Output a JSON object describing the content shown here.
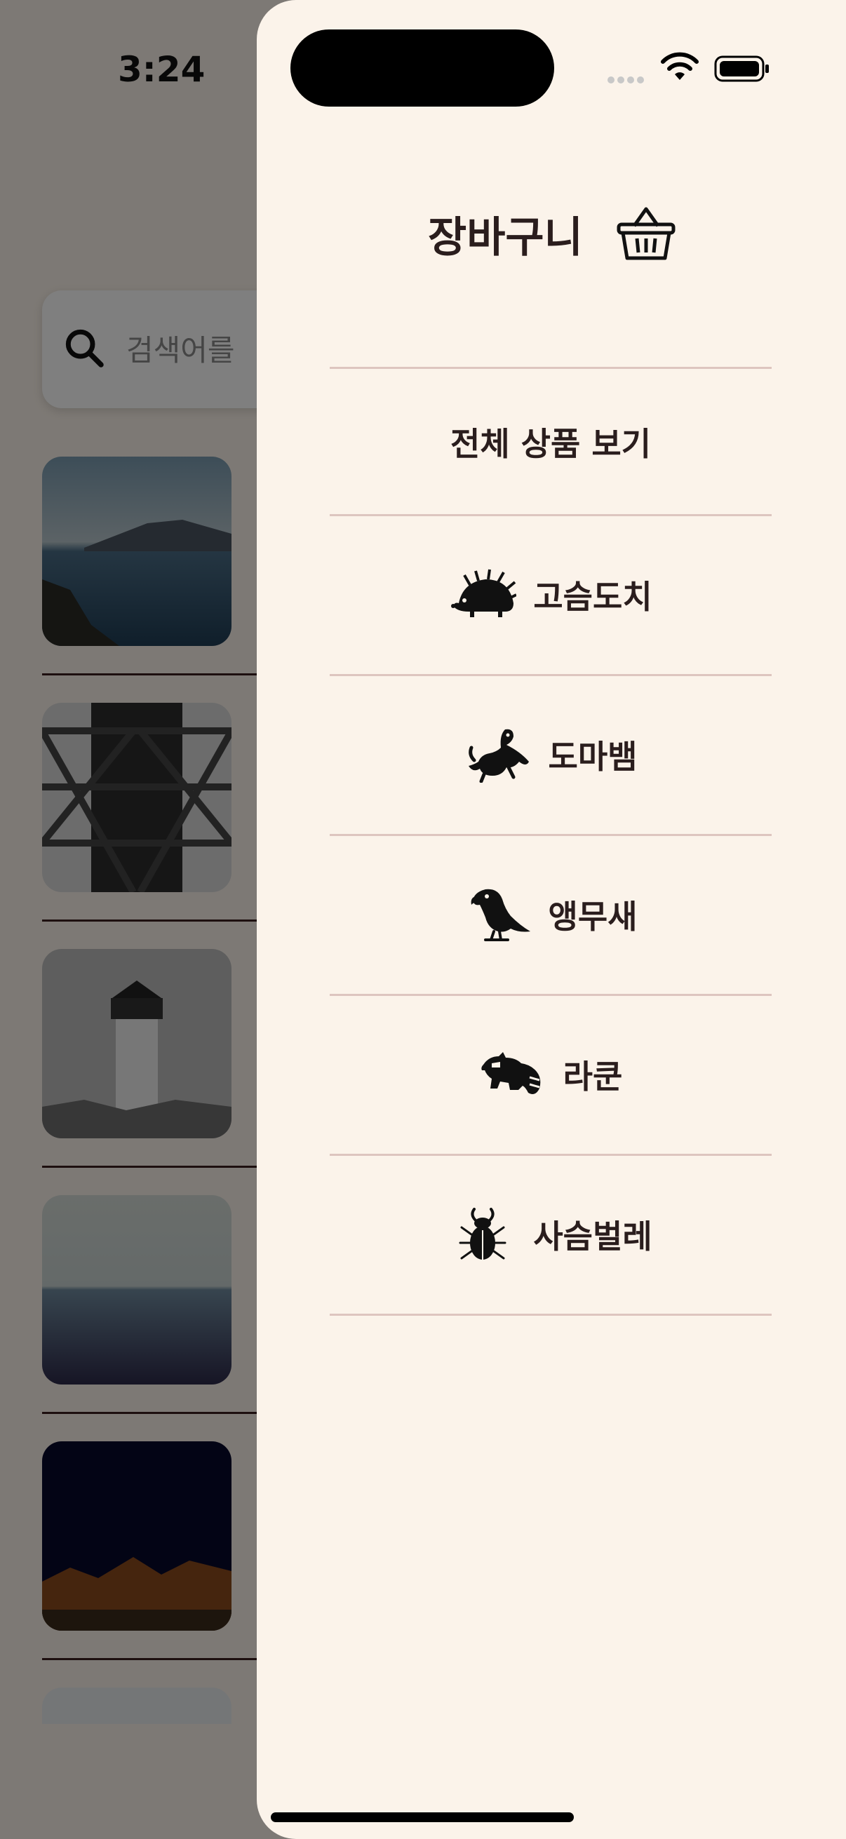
{
  "status_bar": {
    "time": "3:24"
  },
  "search": {
    "placeholder": "검색어를"
  },
  "drawer": {
    "title": "장바구니",
    "menu_items": [
      {
        "label": "전체 상품 보기",
        "icon": ""
      },
      {
        "label": "고슴도치",
        "icon": "hedgehog-icon"
      },
      {
        "label": "도마뱀",
        "icon": "lizard-icon"
      },
      {
        "label": "앵무새",
        "icon": "parrot-icon"
      },
      {
        "label": "라쿤",
        "icon": "raccoon-icon"
      },
      {
        "label": "사슴벌레",
        "icon": "stag-beetle-icon"
      }
    ]
  },
  "colors": {
    "drawer_bg": "#fbf3ea",
    "divider": "#ddc5bf",
    "text": "#2a1d1d"
  }
}
